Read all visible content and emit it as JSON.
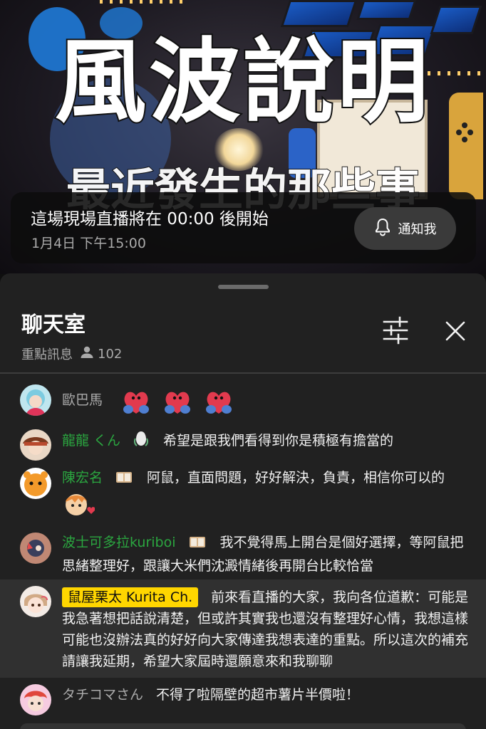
{
  "video": {
    "thumbnail_title": "風波說明",
    "thumbnail_subtitle": "最近發生的那些事",
    "banner_title": "這場現場直播將在 00:00 後開始",
    "banner_time": "1月4日 下午15:00",
    "notify_label": "通知我"
  },
  "chat": {
    "title": "聊天室",
    "mode": "重點訊息",
    "viewer_count": "102",
    "messages": [
      {
        "author": "歐巴馬",
        "text": "",
        "emoji_count": 3
      },
      {
        "author": "龍龍 くん",
        "text": "希望是跟我們看得到你是積極有擔當的"
      },
      {
        "author": "陳宏名",
        "text": "阿鼠，直面問題，好好解決，負責，相信你可以的"
      },
      {
        "author": "波士可多拉kuriboi",
        "text": "我不覺得馬上開台是個好選擇，等阿鼠把思緒整理好，跟讓大米們沈澱情緒後再開台比較恰當"
      },
      {
        "author": "鼠屋栗太 Kurita Ch.",
        "text": "前來看直播的大家，我向各位道歉：可能是我急著想把話說清楚，但或許其實我也還沒有整理好心情，我想這樣可能也沒辦法真的好好向大家傳達我想表達的重點。所以這次的補充請讓我延期，希望大家屆時還願意來和我聊聊"
      },
      {
        "author": "タチコマさん",
        "text": "不得了啦隔壁的超市薯片半價啦！"
      }
    ]
  },
  "colors": {
    "member_green": "#2ba640",
    "owner_yellow": "#ffd600",
    "panel_bg": "#212121"
  }
}
